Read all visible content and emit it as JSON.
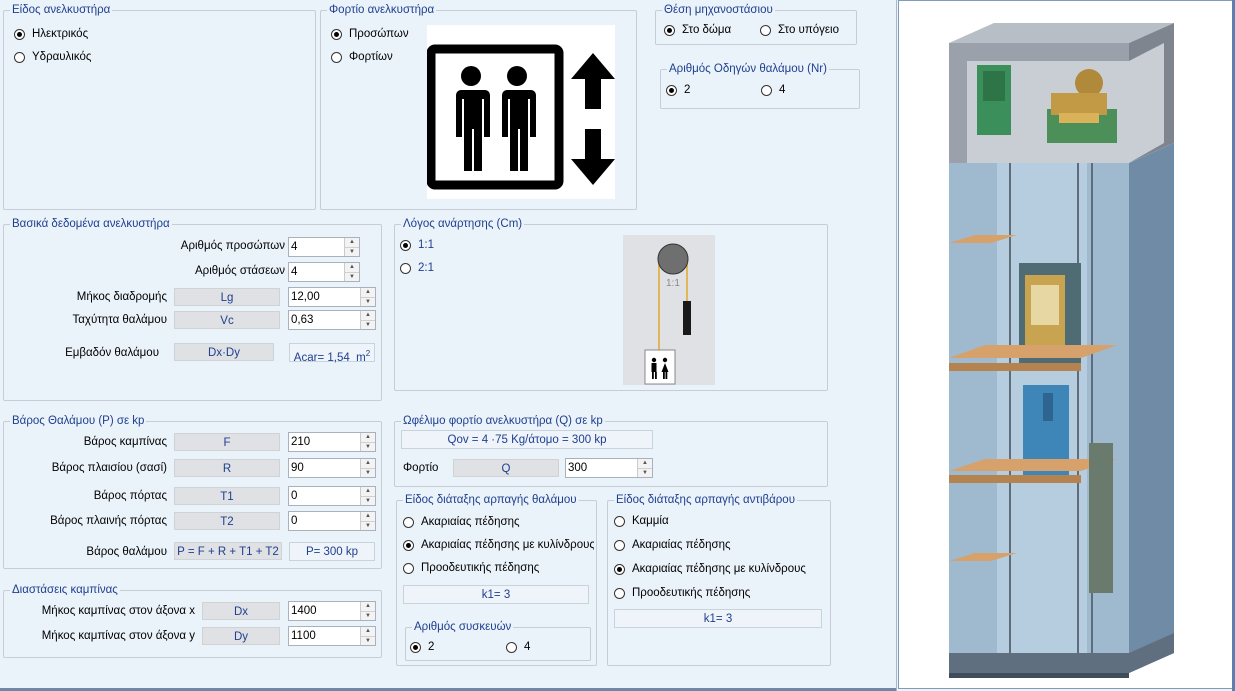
{
  "lift_type": {
    "title": "Είδος ανελκυστήρα",
    "options": [
      "Ηλεκτρικός",
      "Υδραυλικός"
    ],
    "selected": 0
  },
  "lift_load": {
    "title": "Φορτίο ανελκυστήρα",
    "options": [
      "Προσώπων",
      "Φορτίων"
    ],
    "selected": 0
  },
  "machine_room": {
    "title": "Θέση μηχανοστάσιου",
    "options": [
      "Στο δώμα",
      "Στο υπόγειο"
    ],
    "selected": 0
  },
  "car_guides": {
    "title": "Αριθμός Οδηγών θαλάμου (Nr)",
    "options": [
      "2",
      "4"
    ],
    "selected": 0
  },
  "basic_data": {
    "title": "Βασικά δεδομένα ανελκυστήρα",
    "persons": {
      "label": "Αριθμός προσώπων",
      "value": "4"
    },
    "stops": {
      "label": "Αριθμός στάσεων",
      "value": "4"
    },
    "travel": {
      "label": "Μήκος διαδρομής",
      "symbol": "Lg",
      "value": "12,00"
    },
    "speed": {
      "label": "Ταχύτητα θαλάμου",
      "symbol": "Vc",
      "value": "0,63"
    },
    "area": {
      "label": "Εμβαδόν θαλάμου",
      "symbol": "Dx·Dy",
      "result": "Acar= 1,54",
      "unit": "m",
      "unit_sup": "2"
    }
  },
  "suspension": {
    "title": "Λόγος ανάρτησης (Cm)",
    "options": [
      "1:1",
      "2:1"
    ],
    "selected": 0,
    "diagram_label": "1:1"
  },
  "car_weight": {
    "title": "Βάρος Θαλάμου (P) σε kp",
    "rows": [
      {
        "label": "Βάρος καμπίνας",
        "symbol": "F",
        "value": "210"
      },
      {
        "label": "Βάρος πλαισίου (σασί)",
        "symbol": "R",
        "value": "90"
      },
      {
        "label": "Βάρος πόρτας",
        "symbol": "T1",
        "value": "0"
      },
      {
        "label": "Βάρος πλαινής πόρτας",
        "symbol": "T2",
        "value": "0"
      }
    ],
    "total": {
      "label": "Βάρος θαλάμου",
      "formula": "P = F + R + T1 + T2",
      "result": "P= 300  kp"
    }
  },
  "useful_load": {
    "title": "Ωφέλιμο φορτίο ανελκυστήρα (Q) σε kp",
    "formula": "Qov = 4 ·75 Kg/άτομο = 300 kp",
    "label": "Φορτίο",
    "symbol": "Q",
    "value": "300"
  },
  "dimensions": {
    "title": "Διαστάσεις καμπίνας",
    "x": {
      "label": "Μήκος καμπίνας στον άξονα x",
      "symbol": "Dx",
      "value": "1400"
    },
    "y": {
      "label": "Μήκος καμπίνας στον άξονα y",
      "symbol": "Dy",
      "value": "1100"
    }
  },
  "car_safety": {
    "title": "Είδος διάταξης αρπαγής θαλάμου",
    "options": [
      "Ακαριαίας πέδησης",
      "Ακαριαίας πέδησης με κυλίνδρους",
      "Προοδευτικής πέδησης"
    ],
    "selected": 1,
    "k1": "k1= 3",
    "devices": {
      "title": "Αριθμός συσκευών",
      "options": [
        "2",
        "4"
      ],
      "selected": 0
    }
  },
  "cw_safety": {
    "title": "Είδος διάταξης αρπαγής αντιβάρου",
    "options": [
      "Καμμία",
      "Ακαριαίας πέδησης",
      "Ακαριαίας πέδησης με κυλίνδρους",
      "Προοδευτικής πέδησης"
    ],
    "selected": 2,
    "k1": "k1= 3"
  },
  "colors": {
    "title_blue": "#1f3f8f",
    "panel_bg": "#eaf2fa",
    "symbol_bg": "#dfe1e4"
  },
  "icons": {
    "elevator": "elevator-people-icon",
    "shaft": "elevator-shaft-illustration"
  }
}
